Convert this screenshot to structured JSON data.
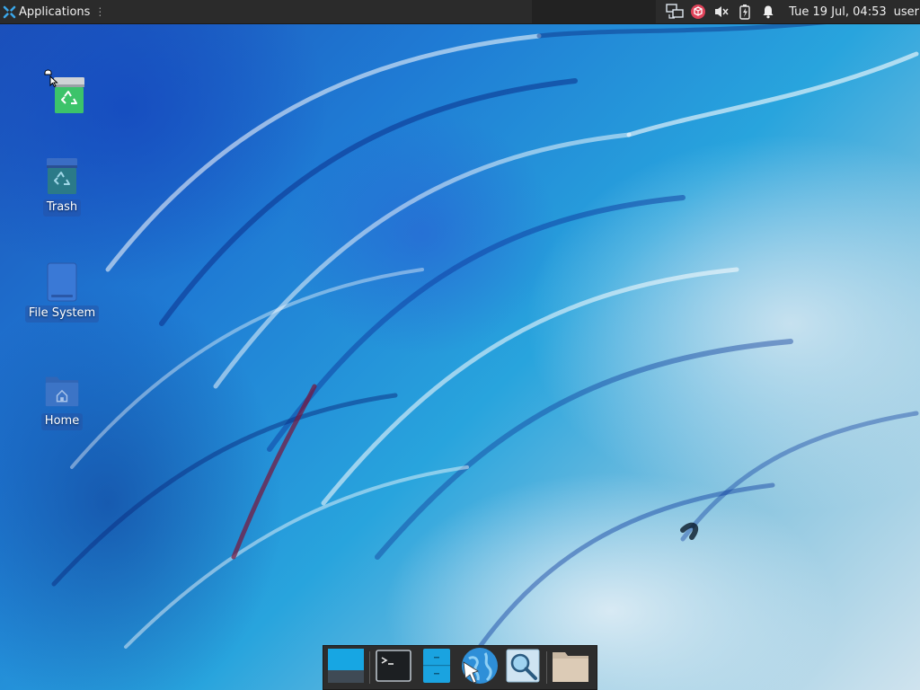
{
  "panel": {
    "applications_label": "Applications",
    "separator_glyph": "⋮",
    "clock": "Tue 19 Jul, 04:53",
    "user": "user",
    "tray_icons": [
      "network-icon",
      "package-updates-icon",
      "volume-muted-icon",
      "battery-charging-icon",
      "notification-bell-icon"
    ]
  },
  "desktop": {
    "icons": [
      {
        "label": "",
        "icon": "recycle-bin-icon"
      },
      {
        "label": "Trash",
        "icon": "trash-icon"
      },
      {
        "label": "File System",
        "icon": "drive-icon"
      },
      {
        "label": "Home",
        "icon": "home-folder-icon"
      }
    ]
  },
  "dock": {
    "items": [
      {
        "icon": "show-desktop-icon"
      },
      {
        "icon": "terminal-icon"
      },
      {
        "icon": "file-manager-icon"
      },
      {
        "icon": "web-browser-icon"
      },
      {
        "icon": "search-icon"
      },
      {
        "icon": "folder-icon"
      }
    ]
  },
  "colors": {
    "panel_bg": "#2b2b2b",
    "accent": "#1aa3e0",
    "recycle_green": "#3cc36a"
  }
}
